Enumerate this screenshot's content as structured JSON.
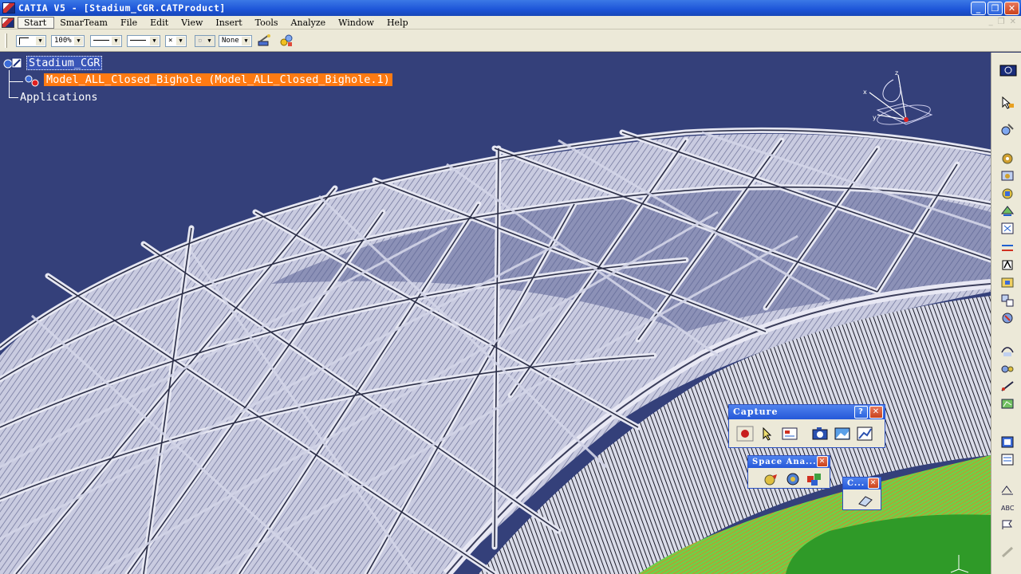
{
  "window": {
    "title": "CATIA V5 - [Stadium_CGR.CATProduct]"
  },
  "menu": {
    "items": [
      "Start",
      "SmarTeam",
      "File",
      "Edit",
      "View",
      "Insert",
      "Tools",
      "Analyze",
      "Window",
      "Help"
    ]
  },
  "toolbar": {
    "zoom_value": "100%",
    "selection_value": "None"
  },
  "tree": {
    "root": "Stadium_CGR",
    "child": "Model_ALL_Closed_Bighole (Model_ALL_Closed_Bighole.1)",
    "applications": "Applications"
  },
  "compass": {
    "x": "x",
    "y": "y",
    "z": "z"
  },
  "capture_toolbar": {
    "title": "Capture",
    "help": "?",
    "close": "✕"
  },
  "space_toolbar": {
    "title": "Space Ana...",
    "close": "✕"
  },
  "small_toolbar": {
    "title": "C...",
    "close": "✕"
  },
  "colors": {
    "background": "#34407a",
    "tree_selection": "#ff7a12",
    "field_green": "#6fd048",
    "track_orange": "#e87a22"
  }
}
